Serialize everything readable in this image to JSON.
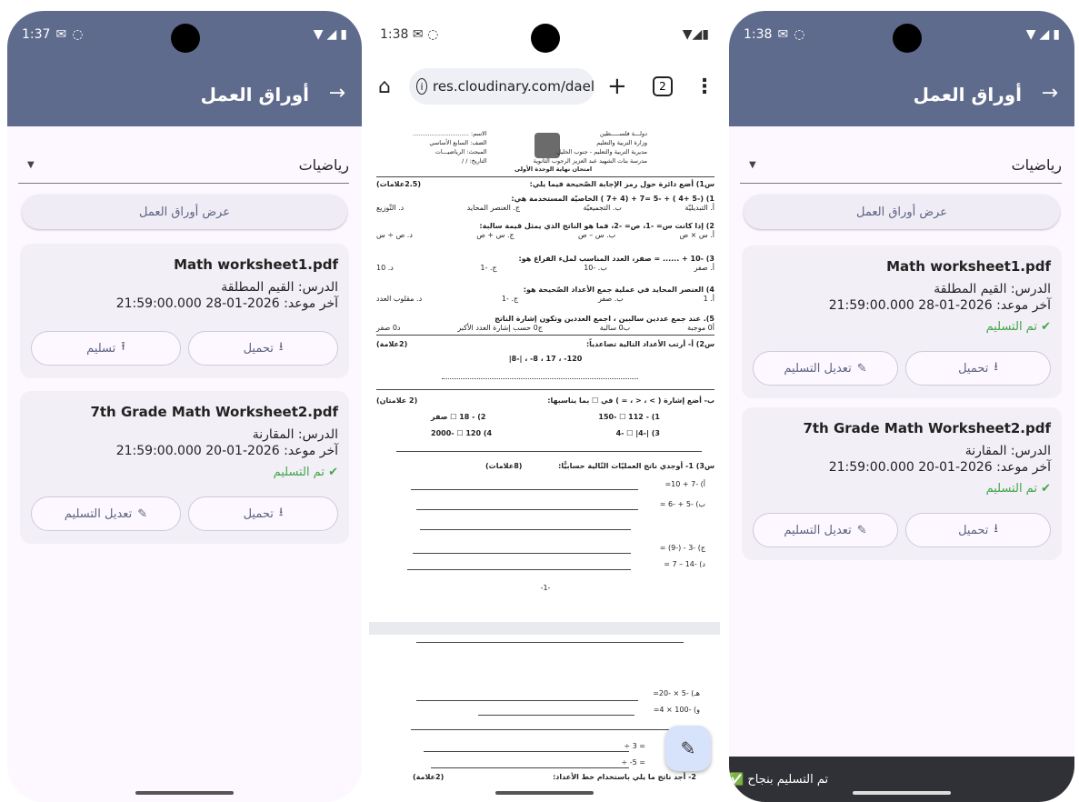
{
  "screen1": {
    "time": "1:37",
    "title": "أوراق العمل",
    "subject": "رياضيات",
    "view_button": "عرض أوراق العمل",
    "cards": [
      {
        "title": "Math worksheet1.pdf",
        "lesson": "الدرس: القيم المطلقة",
        "deadline": "آخر موعد: 2026-01-28 21:59:00.000",
        "status": "",
        "btn_download": "تحميل",
        "btn_action": "تسليم"
      },
      {
        "title": "7th Grade Math Worksheet2.pdf",
        "lesson": "الدرس: المقارنة",
        "deadline": "آخر موعد: 2026-01-20 21:59:00.000",
        "status": "تم التسليم",
        "btn_download": "تحميل",
        "btn_action": "تعديل التسليم"
      }
    ]
  },
  "screen2": {
    "time": "1:38",
    "url": "res.cloudinary.com/dael",
    "tab_count": "2",
    "doc": {
      "header_right": [
        "دولـــة فلســـــطين",
        "وزارة التربية والتعليم",
        "مديرية التربية والتعليم - جنوب الخليل",
        "مدرسة بنات الشهيد عبد العزيز الرجوب الثانوية"
      ],
      "header_left": [
        "الاسم: ..............................",
        "الصف: السابع الأساسي",
        "المبحث: الرياضيـــات",
        "التاريخ: /   /"
      ],
      "exam_title": "امتحان نهاية الوحدة الأولى",
      "q1": "س1) أضع دائرة حول رمز الإجابة الصّحيحة فيما يلي:",
      "q1_marks": "(2.5علامات)",
      "q1_1": "1) (-5 +4 ) + -5 =7 + (4 +7 ) الخاصيّة المستخدمة هي:",
      "q1_1_opts": [
        "أ. التبديليّة",
        "ب. التجميعيّة",
        "ج. العنصر المحايد",
        "د. التّوزيع"
      ],
      "q1_2": "2) إذا كانت س= -1، ص= -2، فما هو الناتج الذي يمثل قيمة سالبة:",
      "q1_2_opts": [
        "أ. س × ص",
        "ب. س – ص",
        "ج. س + ص",
        "د. ص ÷ س"
      ],
      "q1_3": "3) -10 + ...... = صفر، العدد المناسب لملء الفراغ هو:",
      "q1_3_opts": [
        "أ. صفر",
        "ب. -10",
        "ج. -1",
        "د. 10"
      ],
      "q1_4": "4) العنصر المحايد في عملية جمع الأعداد الصّحيحة هو:",
      "q1_4_opts": [
        "أ. 1",
        "ب. صفر",
        "ج. -1",
        "د. مقلوب العدد"
      ],
      "q1_5": "5). عند جمع عددين سالبين ، اجمع العددين وتكون إشارة الناتج",
      "q1_5_opts": [
        "أ0 موجبة",
        "ب0 سالبة",
        "ج0 حسب إشارة العدد الأكبر",
        "د0 صفر"
      ],
      "q2": "س2) أ- أرتب الأعداد التالية تصاعدياً:",
      "q2_marks": "(2علامة)",
      "q2_vals": "120- ، 17 ، 8- ، |-8|",
      "q2b": "ب- أضع إشارة ( > ، < ، = ) في ☐ بما يناسبها:",
      "q2b_marks": "(2 علامتان)",
      "q2b_r1": [
        "1) - 112 ☐ -150",
        "2) - 18 ☐ صفر"
      ],
      "q2b_r2": [
        "3) |-4| ☐ -4",
        "4) 120 ☐ -2000"
      ],
      "q3": "س3) 1- أوجدي ناتج العمليّات التّالية حسابيًّا:",
      "q3_marks": "(8علامات)",
      "q3_items": [
        "أ) -7 + 10=",
        "ب) -5 + -6 =",
        "ج) -3 - (-9) =",
        "د) -14 – 7 ="
      ],
      "page_no": "-1-",
      "q3_items2": [
        "هـ) -5 × -20=",
        "و) -100 × 4=",
        "= 3 ÷",
        "= 5- ÷"
      ],
      "q4": "2- أجد ناتج ما يلي باستخدام خط الأعداد:",
      "q4_marks": "(2علامة)"
    }
  },
  "screen3": {
    "time": "1:38",
    "title": "أوراق العمل",
    "subject": "رياضيات",
    "view_button": "عرض أوراق العمل",
    "cards": [
      {
        "title": "Math worksheet1.pdf",
        "lesson": "الدرس: القيم المطلقة",
        "deadline": "آخر موعد: 2026-01-28 21:59:00.000",
        "status": "تم التسليم",
        "btn_download": "تحميل",
        "btn_action": "تعديل التسليم"
      },
      {
        "title": "7th Grade Math Worksheet2.pdf",
        "lesson": "الدرس: المقارنة",
        "deadline": "آخر موعد: 2026-01-20 21:59:00.000",
        "status": "تم التسليم",
        "btn_download": "تحميل",
        "btn_action": "تعديل التسليم"
      }
    ],
    "snackbar": "تم التسليم بنجاح ✅"
  },
  "colors": {
    "appbar": "#5f6b8c",
    "success": "#3fa64a",
    "accent": "#5b6380"
  }
}
